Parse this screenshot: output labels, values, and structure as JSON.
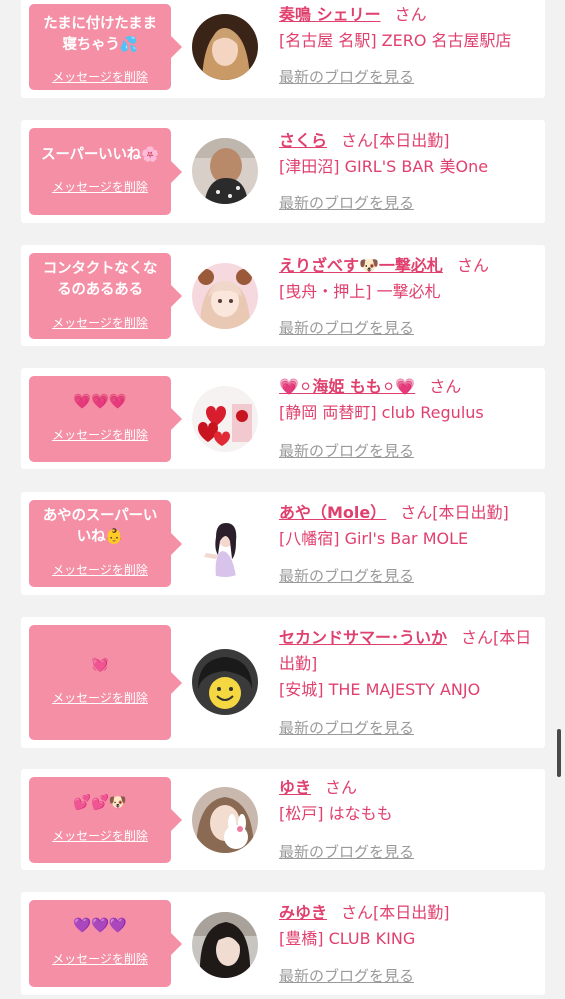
{
  "messages": [
    {
      "bubble_text": "たまに付けたまま\n寝ちゃう💦",
      "delete_label": "メッセージを削除",
      "name": "奏鳴 シェリー",
      "honorific": "さん",
      "status": "",
      "shop": "[名古屋 名駅] ZERO 名古屋駅店",
      "blog_label": "最新のブログを見る",
      "avatar_icon": "girl-portrait-photo"
    },
    {
      "bubble_text": "スーパーいいね🌸",
      "delete_label": "メッセージを削除",
      "name": "さくら",
      "honorific": "さん",
      "status": "[本日出勤]",
      "shop": "[津田沼] GIRL'S BAR 美One",
      "blog_label": "最新のブログを見る",
      "avatar_icon": "girl-back-view-photo"
    },
    {
      "bubble_text": "コンタクトなくな\nるのあるある",
      "delete_label": "メッセージを削除",
      "name": "えりざべす🐶一撃必札",
      "honorific": "さん",
      "status": "",
      "shop": "[曳舟・押上] 一撃必札",
      "blog_label": "最新のブログを見る",
      "avatar_icon": "girl-bear-ears-photo"
    },
    {
      "bubble_text": "💗💗💗",
      "delete_label": "メッセージを削除",
      "name": "💗⚪海姫 もも⚪💗",
      "honorific": "さん",
      "status": "",
      "shop": "[静岡 両替町] club Regulus",
      "blog_label": "最新のブログを見る",
      "avatar_icon": "heart-balloons-photo"
    },
    {
      "bubble_text": "あやのスーパーい\nいね👶",
      "delete_label": "メッセージを削除",
      "name": "あや（Mole）",
      "honorific": "さん",
      "status": "[本日出勤]",
      "shop": "[八幡宿] Girl's Bar MOLE",
      "blog_label": "最新のブログを見る",
      "avatar_icon": "girl-posing-photo"
    },
    {
      "bubble_text": "💓",
      "delete_label": "メッセージを削除",
      "name": "セカンドサマー･ういか",
      "honorific": "さん",
      "status": "[本日出勤]",
      "shop": "[安城] THE MAJESTY ANJO",
      "blog_label": "最新のブログを見る",
      "avatar_icon": "smiley-face-photo"
    },
    {
      "bubble_text": "💕💕🐶",
      "delete_label": "メッセージを削除",
      "name": "ゆき",
      "honorific": "さん",
      "status": "",
      "shop": "[松戸] はなもも",
      "blog_label": "最新のブログを見る",
      "avatar_icon": "girl-rabbit-sticker-photo"
    },
    {
      "bubble_text": "💜💜💜",
      "delete_label": "メッセージを削除",
      "name": "みゆき",
      "honorific": "さん",
      "status": "[本日出勤]",
      "shop": "[豊橋] CLUB KING",
      "blog_label": "最新のブログを見る",
      "avatar_icon": "girl-selfie-photo"
    }
  ],
  "colors": {
    "bubble": "#f48fa5",
    "accent": "#e0406e",
    "muted": "#9a9a9a",
    "background": "#f2f2f2"
  }
}
